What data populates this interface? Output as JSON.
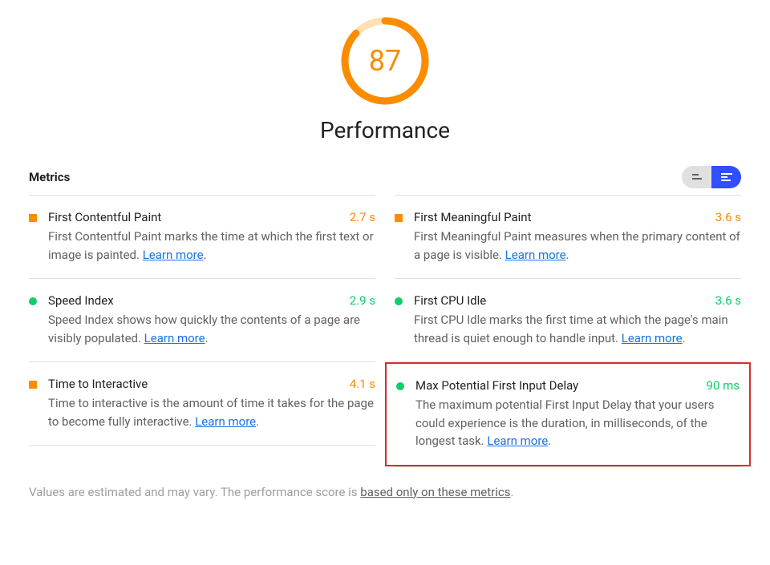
{
  "gauge": {
    "score": "87",
    "percent": 87,
    "color": "#fb8c00"
  },
  "category_title": "Performance",
  "metrics_label": "Metrics",
  "learn_more": "Learn more",
  "left": [
    {
      "name": "First Contentful Paint",
      "value": "2.7 s",
      "status": "orange",
      "desc_pre": "First Contentful Paint marks the time at which the first text or image is painted. "
    },
    {
      "name": "Speed Index",
      "value": "2.9 s",
      "status": "green",
      "desc_pre": "Speed Index shows how quickly the contents of a page are visibly populated. "
    },
    {
      "name": "Time to Interactive",
      "value": "4.1 s",
      "status": "orange",
      "desc_pre": "Time to interactive is the amount of time it takes for the page to become fully interactive. "
    }
  ],
  "right": [
    {
      "name": "First Meaningful Paint",
      "value": "3.6 s",
      "status": "orange",
      "desc_pre": "First Meaningful Paint measures when the primary content of a page is visible. "
    },
    {
      "name": "First CPU Idle",
      "value": "3.6 s",
      "status": "green",
      "desc_pre": "First CPU Idle marks the first time at which the page's main thread is quiet enough to handle input. "
    },
    {
      "name": "Max Potential First Input Delay",
      "value": "90 ms",
      "status": "green",
      "highlight": true,
      "desc_pre": "The maximum potential First Input Delay that your users could experience is the duration, in milliseconds, of the longest task. "
    }
  ],
  "footer_pre": "Values are estimated and may vary. The performance score is ",
  "footer_link": "based only on these metrics",
  "footer_post": "."
}
